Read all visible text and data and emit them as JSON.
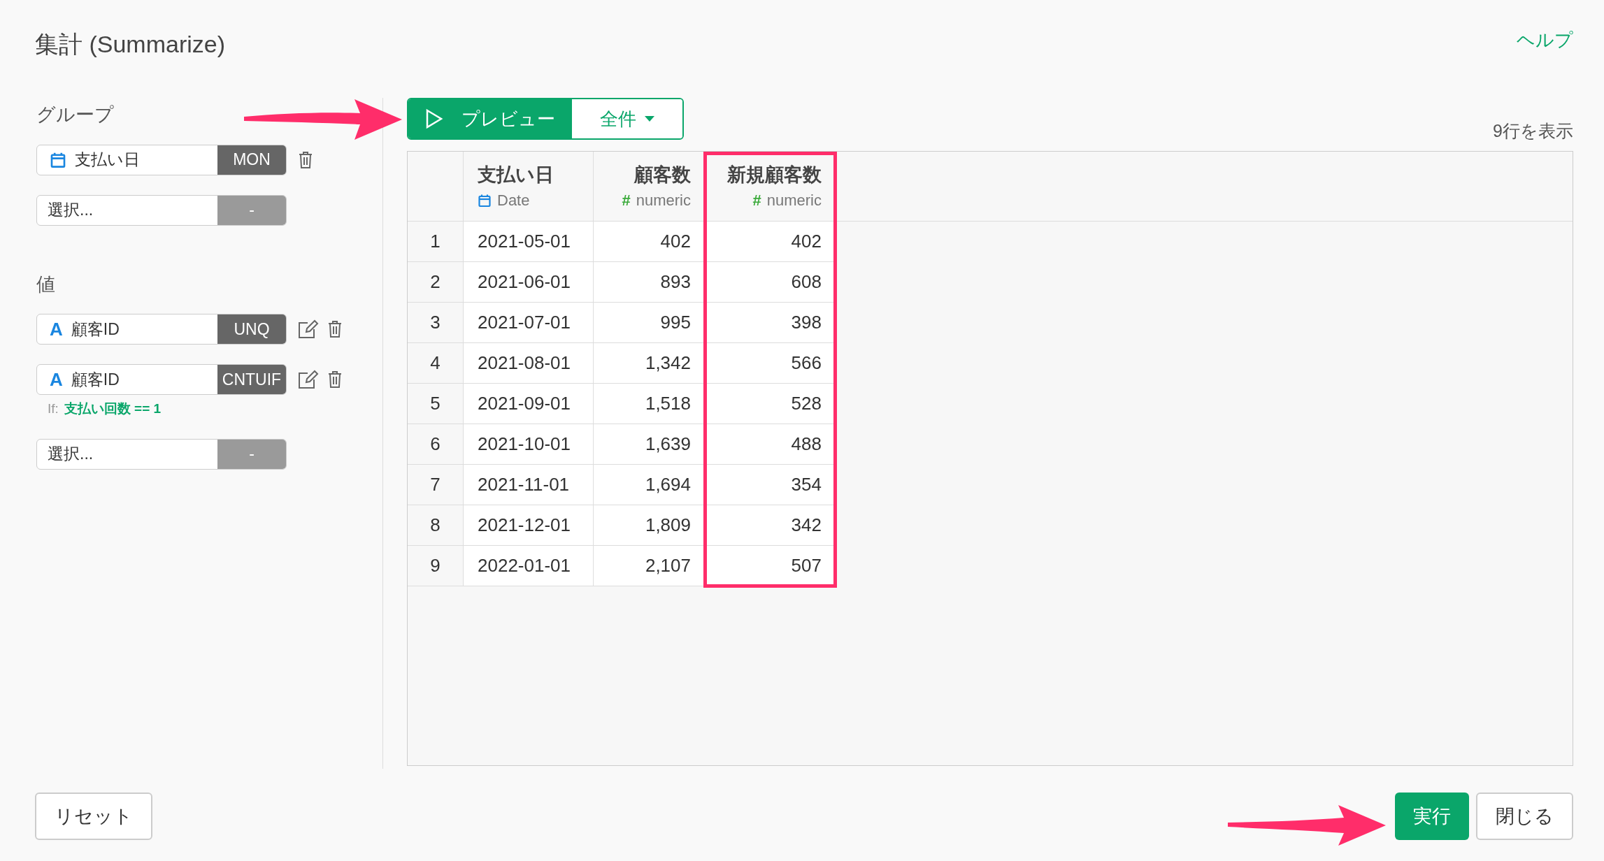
{
  "title": "集計 (Summarize)",
  "help_link": "ヘルプ",
  "group": {
    "label": "グループ",
    "items": [
      {
        "kind": "date",
        "name": "支払い日",
        "agg": "MON",
        "editable": false
      }
    ],
    "select": {
      "placeholder": "選択...",
      "agg": "-"
    }
  },
  "values": {
    "label": "値",
    "items": [
      {
        "kind": "text",
        "type_mark": "A",
        "name": "顧客ID",
        "agg": "UNQ",
        "editable": true
      },
      {
        "kind": "text",
        "type_mark": "A",
        "name": "顧客ID",
        "agg": "CNTUIF",
        "editable": true,
        "condition": {
          "label": "If:",
          "expression": "支払い回数 == 1"
        }
      }
    ],
    "select": {
      "placeholder": "選択...",
      "agg": "-"
    }
  },
  "toolbar": {
    "preview_button": "プレビュー",
    "rows_dropdown": "全件",
    "row_count": "9行を表示"
  },
  "table": {
    "columns": [
      {
        "name": "支払い日",
        "kind": "date",
        "type_label": "Date",
        "highlighted": false
      },
      {
        "name": "顧客数",
        "kind": "numeric",
        "type_mark": "#",
        "type_label": "numeric",
        "highlighted": false
      },
      {
        "name": "新規顧客数",
        "kind": "numeric",
        "type_mark": "#",
        "type_label": "numeric",
        "highlighted": true
      }
    ],
    "rows": [
      {
        "index": "1",
        "cells": [
          "2021-05-01",
          "402",
          "402"
        ]
      },
      {
        "index": "2",
        "cells": [
          "2021-06-01",
          "893",
          "608"
        ]
      },
      {
        "index": "3",
        "cells": [
          "2021-07-01",
          "995",
          "398"
        ]
      },
      {
        "index": "4",
        "cells": [
          "2021-08-01",
          "1,342",
          "566"
        ]
      },
      {
        "index": "5",
        "cells": [
          "2021-09-01",
          "1,518",
          "528"
        ]
      },
      {
        "index": "6",
        "cells": [
          "2021-10-01",
          "1,639",
          "488"
        ]
      },
      {
        "index": "7",
        "cells": [
          "2021-11-01",
          "1,694",
          "354"
        ]
      },
      {
        "index": "8",
        "cells": [
          "2021-12-01",
          "1,809",
          "342"
        ]
      },
      {
        "index": "9",
        "cells": [
          "2022-01-01",
          "2,107",
          "507"
        ]
      }
    ]
  },
  "footer": {
    "reset_button": "リセット",
    "run_button": "実行",
    "close_button": "閉じる"
  }
}
